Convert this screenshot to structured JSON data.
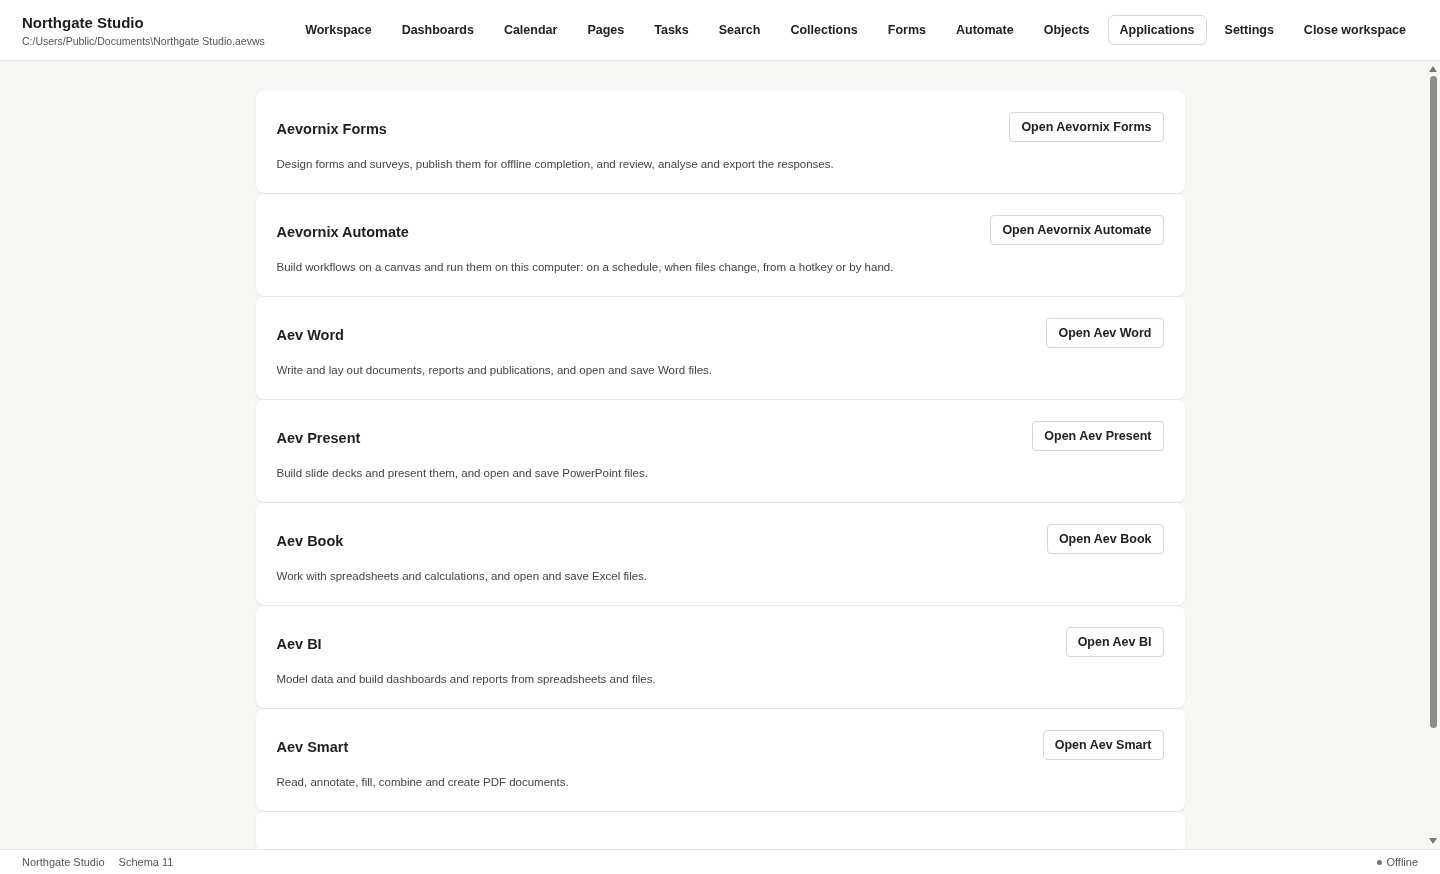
{
  "app": {
    "title": "Northgate Studio",
    "path": "C:/Users/Public/Documents\\Northgate Studio.aevws"
  },
  "nav": [
    {
      "label": "Workspace",
      "selected": false
    },
    {
      "label": "Dashboards",
      "selected": false
    },
    {
      "label": "Calendar",
      "selected": false
    },
    {
      "label": "Pages",
      "selected": false
    },
    {
      "label": "Tasks",
      "selected": false
    },
    {
      "label": "Search",
      "selected": false
    },
    {
      "label": "Collections",
      "selected": false
    },
    {
      "label": "Forms",
      "selected": false
    },
    {
      "label": "Automate",
      "selected": false
    },
    {
      "label": "Objects",
      "selected": false
    },
    {
      "label": "Applications",
      "selected": true
    },
    {
      "label": "Settings",
      "selected": false
    },
    {
      "label": "Close workspace",
      "selected": false
    }
  ],
  "applications": [
    {
      "name": "Aevornix Forms",
      "button": "Open Aevornix Forms",
      "description": "Design forms and surveys, publish them for offline completion, and review, analyse and export the responses."
    },
    {
      "name": "Aevornix Automate",
      "button": "Open Aevornix Automate",
      "description": "Build workflows on a canvas and run them on this computer: on a schedule, when files change, from a hotkey or by hand."
    },
    {
      "name": "Aev Word",
      "button": "Open Aev Word",
      "description": "Write and lay out documents, reports and publications, and open and save Word files."
    },
    {
      "name": "Aev Present",
      "button": "Open Aev Present",
      "description": "Build slide decks and present them, and open and save PowerPoint files."
    },
    {
      "name": "Aev Book",
      "button": "Open Aev Book",
      "description": "Work with spreadsheets and calculations, and open and save Excel files."
    },
    {
      "name": "Aev BI",
      "button": "Open Aev BI",
      "description": "Model data and build dashboards and reports from spreadsheets and files."
    },
    {
      "name": "Aev Smart",
      "button": "Open Aev Smart",
      "description": "Read, annotate, fill, combine and create PDF documents."
    }
  ],
  "status_bar": {
    "app": "Northgate Studio",
    "schema": "Schema 11",
    "connection": "Offline"
  }
}
